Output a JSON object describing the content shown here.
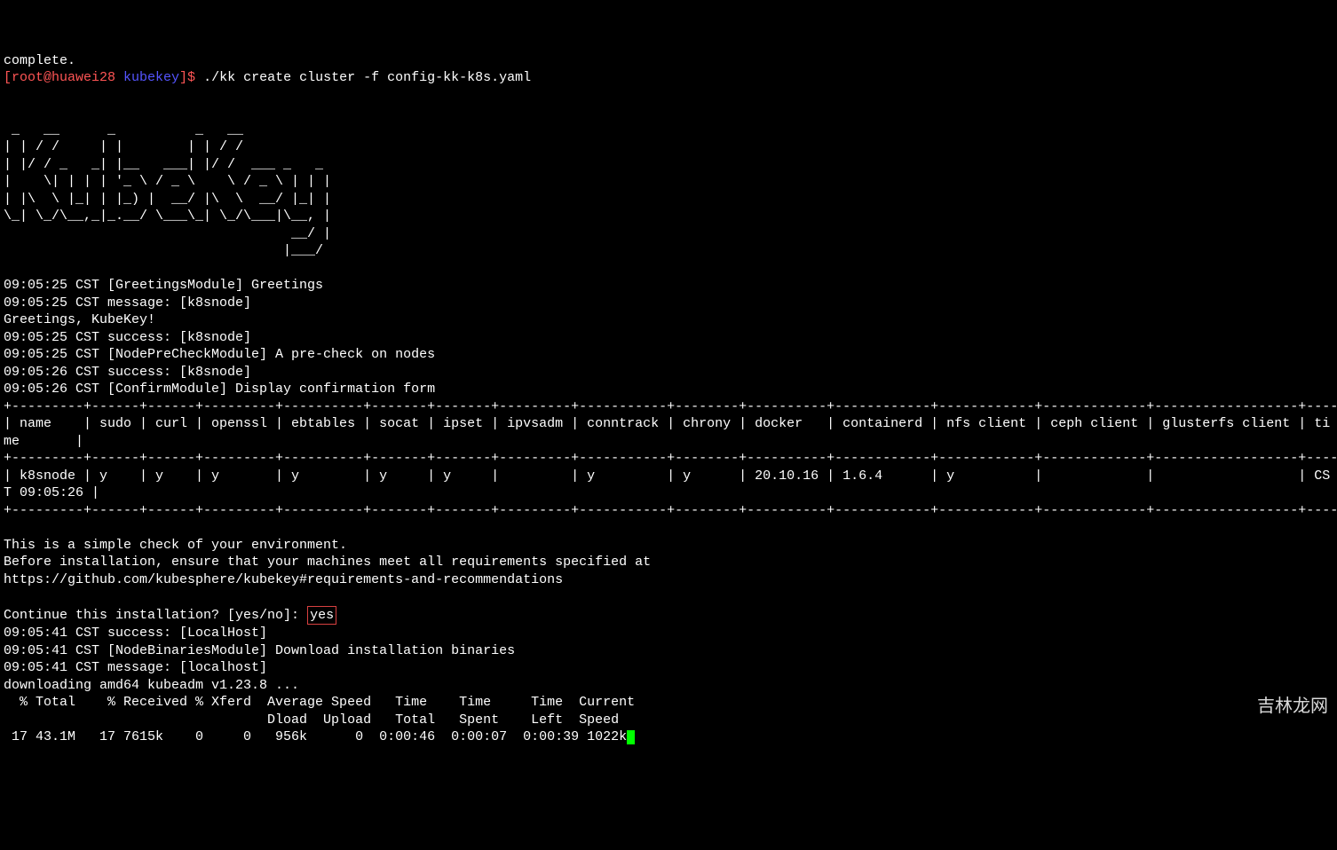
{
  "top_truncated": "complete.",
  "prompt": {
    "user_host": "[root@huawei28 ",
    "cwd": "kubekey",
    "suffix": "]$ ",
    "command": "./kk create cluster -f config-kk-k8s.yaml"
  },
  "ascii_art": " _   __      _          _   __           \n| | / /     | |        | | / /           \n| |/ / _   _| |__   ___| |/ /  ___ _   _ \n|    \\| | | | '_ \\ / _ \\    \\ / _ \\ | | |\n| |\\  \\ |_| | |_) |  __/ |\\  \\  __/ |_| |\n\\_| \\_/\\__,_|_.__/ \\___\\_| \\_/\\___|\\__, |\n                                    __/ |\n                                   |___/ ",
  "log": {
    "l1": "09:05:25 CST [GreetingsModule] Greetings",
    "l2": "09:05:25 CST message: [k8snode]",
    "l3": "Greetings, KubeKey!",
    "l4": "09:05:25 CST success: [k8snode]",
    "l5": "09:05:25 CST [NodePreCheckModule] A pre-check on nodes",
    "l6": "09:05:26 CST success: [k8snode]",
    "l7": "09:05:26 CST [ConfirmModule] Display confirmation form"
  },
  "table": {
    "divider": "+---------+------+------+---------+----------+-------+-------+---------+-----------+--------+----------+------------+------------+-------------+------------------+--------------+",
    "header": "| name    | sudo | curl | openssl | ebtables | socat | ipset | ipvsadm | conntrack | chrony | docker   | containerd | nfs client | ceph client | glusterfs client | ti",
    "header_wrap": "me       |",
    "row": "| k8snode | y    | y    | y       | y        | y     | y     |         | y         | y      | 20.10.16 | 1.6.4      | y          |             |                  | CS",
    "row_wrap": "T 09:05:26 |"
  },
  "info": {
    "l1": "This is a simple check of your environment.",
    "l2": "Before installation, ensure that your machines meet all requirements specified at",
    "l3": "https://github.com/kubesphere/kubekey#requirements-and-recommendations"
  },
  "confirm": {
    "prompt": "Continue this installation? [yes/no]: ",
    "answer": "yes"
  },
  "post": {
    "l1": "09:05:41 CST success: [LocalHost]",
    "l2": "09:05:41 CST [NodeBinariesModule] Download installation binaries",
    "l3": "09:05:41 CST message: [localhost]",
    "l4": "downloading amd64 kubeadm v1.23.8 ..."
  },
  "curl": {
    "h1": "  % Total    % Received % Xferd  Average Speed   Time    Time     Time  Current",
    "h2": "                                 Dload  Upload   Total   Spent    Left  Speed",
    "row": " 17 43.1M   17 7615k    0     0   956k      0  0:00:46  0:00:07  0:00:39 1022k"
  },
  "watermark": "吉林龙网"
}
